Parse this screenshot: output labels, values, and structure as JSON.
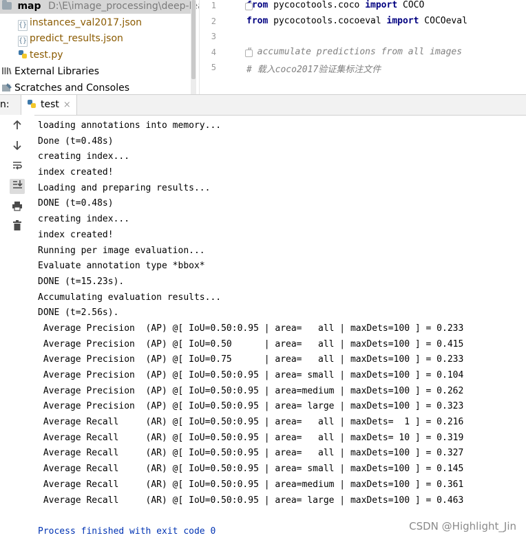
{
  "project_tree": {
    "root_name": "map",
    "root_path": "D:\\E\\image_processing\\deep-learn",
    "files": [
      {
        "name": "instances_val2017.json",
        "type": "json"
      },
      {
        "name": "predict_results.json",
        "type": "json"
      },
      {
        "name": "test.py",
        "type": "python"
      }
    ],
    "external_libraries": "External Libraries",
    "scratches": "Scratches and Consoles"
  },
  "editor": {
    "lines": [
      {
        "num": "1",
        "parts": [
          {
            "t": "from",
            "k": "kw"
          },
          {
            "t": " pycocotools.coco ",
            "k": "n"
          },
          {
            "t": "import",
            "k": "kw"
          },
          {
            "t": " COCO",
            "k": "n"
          }
        ]
      },
      {
        "num": "2",
        "parts": [
          {
            "t": "from",
            "k": "kw"
          },
          {
            "t": " pycocotools.cocoeval ",
            "k": "n"
          },
          {
            "t": "import",
            "k": "kw"
          },
          {
            "t": " COCOeval",
            "k": "n"
          }
        ]
      },
      {
        "num": "3",
        "parts": []
      },
      {
        "num": "4",
        "parts": [
          {
            "t": "# accumulate predictions from all images",
            "k": "cm"
          }
        ]
      },
      {
        "num": "5",
        "parts": [
          {
            "t": "# 载入coco2017验证集标注文件",
            "k": "cm"
          }
        ]
      }
    ]
  },
  "run_panel": {
    "label": "n:",
    "tab_name": "test",
    "close_glyph": "×"
  },
  "toolbar": {
    "icons": [
      "arrow-up-icon",
      "arrow-down-icon",
      "soft-wrap-icon",
      "scroll-to-end-icon",
      "print-icon",
      "trash-icon"
    ]
  },
  "console_lines": [
    "loading annotations into memory...",
    "Done (t=0.48s)",
    "creating index...",
    "index created!",
    "Loading and preparing results...",
    "DONE (t=0.48s)",
    "creating index...",
    "index created!",
    "Running per image evaluation...",
    "Evaluate annotation type *bbox*",
    "DONE (t=15.23s).",
    "Accumulating evaluation results...",
    "DONE (t=2.56s).",
    " Average Precision  (AP) @[ IoU=0.50:0.95 | area=   all | maxDets=100 ] = 0.233",
    " Average Precision  (AP) @[ IoU=0.50      | area=   all | maxDets=100 ] = 0.415",
    " Average Precision  (AP) @[ IoU=0.75      | area=   all | maxDets=100 ] = 0.233",
    " Average Precision  (AP) @[ IoU=0.50:0.95 | area= small | maxDets=100 ] = 0.104",
    " Average Precision  (AP) @[ IoU=0.50:0.95 | area=medium | maxDets=100 ] = 0.262",
    " Average Precision  (AP) @[ IoU=0.50:0.95 | area= large | maxDets=100 ] = 0.323",
    " Average Recall     (AR) @[ IoU=0.50:0.95 | area=   all | maxDets=  1 ] = 0.216",
    " Average Recall     (AR) @[ IoU=0.50:0.95 | area=   all | maxDets= 10 ] = 0.319",
    " Average Recall     (AR) @[ IoU=0.50:0.95 | area=   all | maxDets=100 ] = 0.327",
    " Average Recall     (AR) @[ IoU=0.50:0.95 | area= small | maxDets=100 ] = 0.145",
    " Average Recall     (AR) @[ IoU=0.50:0.95 | area=medium | maxDets=100 ] = 0.361",
    " Average Recall     (AR) @[ IoU=0.50:0.95 | area= large | maxDets=100 ] = 0.463"
  ],
  "process_finished": "Process finished with exit code 0",
  "watermark": "CSDN @Highlight_Jin",
  "colors": {
    "keyword": "#000080",
    "comment": "#808080",
    "finished": "#0033b3",
    "selection": "#d6d6d6"
  }
}
